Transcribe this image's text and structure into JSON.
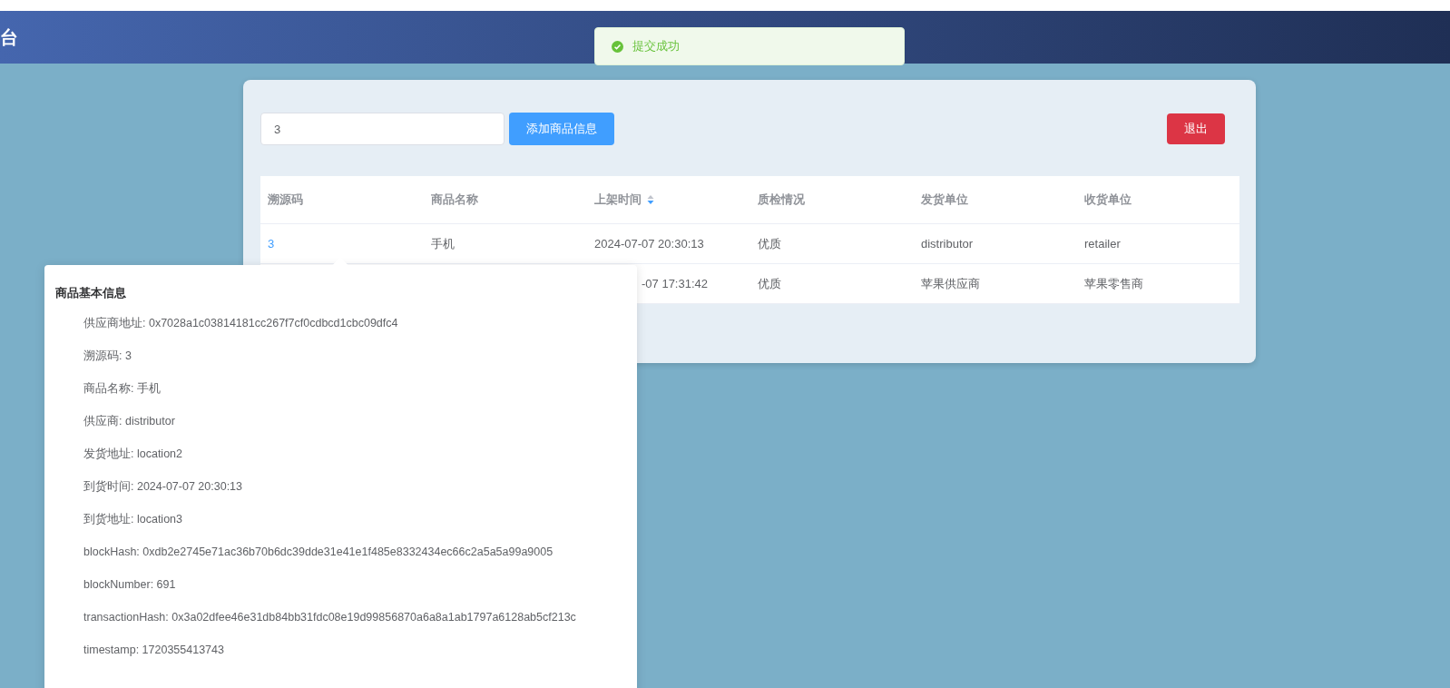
{
  "header": {
    "title": "台"
  },
  "toast": {
    "kind": "success",
    "message": "提交成功"
  },
  "toolbar": {
    "search": {
      "value": "3"
    },
    "add_button": "添加商品信息",
    "logout_button": "退出"
  },
  "table": {
    "columns": [
      {
        "label": "溯源码",
        "sortable": false
      },
      {
        "label": "商品名称",
        "sortable": false
      },
      {
        "label": "上架时间",
        "sortable": true,
        "descending": true
      },
      {
        "label": "质检情况",
        "sortable": false
      },
      {
        "label": "发货单位",
        "sortable": false
      },
      {
        "label": "收货单位",
        "sortable": false
      }
    ],
    "rows": [
      {
        "cells": [
          "3",
          "手机",
          "2024-07-07 20:30:13",
          "优质",
          "distributor",
          "retailer"
        ]
      },
      {
        "cells": [
          null,
          null,
          "-07 17:31:42",
          "优质",
          "苹果供应商",
          "苹果零售商"
        ]
      }
    ]
  },
  "popover": {
    "title": "商品基本信息",
    "lines": [
      "供应商地址: 0x7028a1c03814181cc267f7cf0cdbcd1cbc09dfc4",
      "溯源码: 3",
      "商品名称: 手机",
      "供应商: distributor",
      "发货地址: location2",
      "到货时间: 2024-07-07 20:30:13",
      "到货地址: location3",
      "blockHash: 0xdb2e2745e71ac36b70b6dc39dde31e41e1f485e8332434ec66c2a5a5a99a9005",
      "blockNumber: 691",
      "transactionHash: 0x3a02dfee46e31db84bb31fdc08e19d99856870a6a8a1ab1797a6128ab5cf213c",
      "timestamp: 1720355413743"
    ]
  }
}
